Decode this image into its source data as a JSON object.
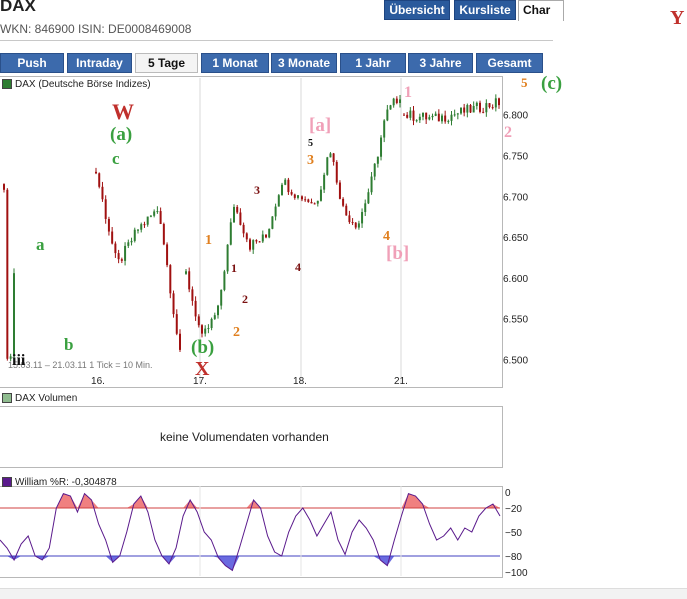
{
  "header": {
    "title": "DAX",
    "wkn_line": "WKN: 846900   ISIN: DE0008469008",
    "top_tabs": [
      {
        "label": "Übersicht",
        "active": false
      },
      {
        "label": "Kursliste",
        "active": false
      },
      {
        "label": "Char",
        "active": true
      }
    ]
  },
  "range_tabs": [
    "Push",
    "Intraday",
    "5 Tage",
    "1 Monat",
    "3 Monate",
    "1 Jahr",
    "3 Jahre",
    "Gesamt"
  ],
  "range_active": "5 Tage",
  "price_panel": {
    "legend": "DAX (Deutsche Börse Indizes)",
    "period_note": "15.03.11 – 21.03.11   1 Tick = 10 Min."
  },
  "volume_panel": {
    "legend": "DAX Volumen",
    "empty_message": "keine Volumendaten vorhanden"
  },
  "williams_panel": {
    "legend": "William %R: -0,304878"
  },
  "colors": {
    "up_candle": "#2e7d32",
    "down_candle": "#a01010",
    "overbought_fill": "#f08080",
    "oversold_fill": "#6a6ae0",
    "wr_line": "#5a1a8c",
    "tab_blue": "#3c6aac"
  },
  "annotations": [
    {
      "text": "Y",
      "color": "#c0302c",
      "size": 20
    },
    {
      "text": "5",
      "color": "#e08020",
      "size": 13
    },
    {
      "text": "(c)",
      "color": "#3aa040",
      "size": 19
    },
    {
      "text": "W",
      "color": "#c0302c",
      "size": 22
    },
    {
      "text": "(a)",
      "color": "#3aa040",
      "size": 19
    },
    {
      "text": "c",
      "color": "#3aa040",
      "size": 17
    },
    {
      "text": "a",
      "color": "#3aa040",
      "size": 17
    },
    {
      "text": "b",
      "color": "#3aa040",
      "size": 17
    },
    {
      "text": "iii",
      "color": "#111111",
      "size": 16
    },
    {
      "text": "(b)",
      "color": "#3aa040",
      "size": 19
    },
    {
      "text": "X",
      "color": "#c0302c",
      "size": 20
    },
    {
      "text": "1",
      "color": "#e08020",
      "size": 14
    },
    {
      "text": "1",
      "color": "#7a1010",
      "size": 12
    },
    {
      "text": "2",
      "color": "#7a1010",
      "size": 12
    },
    {
      "text": "2",
      "color": "#e08020",
      "size": 14
    },
    {
      "text": "3",
      "color": "#7a1010",
      "size": 12
    },
    {
      "text": "4",
      "color": "#7a1010",
      "size": 12
    },
    {
      "text": "5",
      "color": "#111111",
      "size": 10
    },
    {
      "text": "3",
      "color": "#e08020",
      "size": 14
    },
    {
      "text": "[a]",
      "color": "#f0a0b8",
      "size": 19
    },
    {
      "text": "4",
      "color": "#e08020",
      "size": 14
    },
    {
      "text": "[b]",
      "color": "#f0a0b8",
      "size": 19
    },
    {
      "text": "1",
      "color": "#f0a0b8",
      "size": 16
    },
    {
      "text": "2",
      "color": "#f0a0b8",
      "size": 16
    }
  ],
  "chart_data": [
    {
      "type": "candlestick",
      "title": "DAX (Deutsche Börse Indizes)",
      "x_tick_labels": [
        "16.",
        "17.",
        "18.",
        "21."
      ],
      "y_tick_labels": [
        "6.500",
        "6.550",
        "6.600",
        "6.650",
        "6.700",
        "6.750",
        "6.800"
      ],
      "ylim": [
        6470,
        6845
      ],
      "grid": "vertical at day boundaries",
      "series": [
        {
          "name": "DAX",
          "x": [
            "15.03. a",
            "15.03. b",
            "15.03. c",
            "15.03. d",
            "15.03. e",
            "15.03. f",
            "15.03. g",
            "16.03. a",
            "16.03. b",
            "16.03. c",
            "16.03. d",
            "16.03. e",
            "17.03. a",
            "17.03. b",
            "17.03. c",
            "17.03. d",
            "17.03. e",
            "17.03. f",
            "17.03. g",
            "17.03. h",
            "18.03. a",
            "18.03. b",
            "18.03. c",
            "18.03. d",
            "18.03. e",
            "18.03. f",
            "18.03. g",
            "18.03. h",
            "21.03. a",
            "21.03. b",
            "21.03. c",
            "21.03. d"
          ],
          "values": [
            6715,
            6605,
            6495,
            6610,
            6510,
            6545,
            6605,
            6730,
            6615,
            6660,
            6685,
            6505,
            6605,
            6525,
            6560,
            6690,
            6640,
            6650,
            6720,
            6700,
            6700,
            6690,
            6760,
            6680,
            6665,
            6720,
            6800,
            6825,
            6800,
            6795,
            6805,
            6815
          ]
        }
      ]
    },
    {
      "type": "line",
      "title": "William %R",
      "y_tick_labels": [
        "0",
        "-20",
        "-50",
        "-80",
        "-100"
      ],
      "ylim": [
        -100,
        0
      ],
      "reference_lines": [
        -20,
        -80
      ],
      "series": [
        {
          "name": "William %R",
          "values": [
            -60,
            -70,
            -85,
            -65,
            -55,
            -80,
            -85,
            -70,
            -20,
            -2,
            -5,
            -25,
            -2,
            -10,
            -40,
            -60,
            -88,
            -80,
            -50,
            -15,
            -5,
            -25,
            -60,
            -80,
            -90,
            -70,
            -30,
            -10,
            -25,
            -50,
            -60,
            -82,
            -92,
            -98,
            -70,
            -40,
            -10,
            -20,
            -55,
            -75,
            -80,
            -50,
            -30,
            -20,
            -35,
            -55,
            -40,
            -25,
            -60,
            -78,
            -50,
            -35,
            -45,
            -60,
            -85,
            -92,
            -60,
            -30,
            -2,
            -5,
            -15,
            -40,
            -60,
            -55,
            -45,
            -60,
            -45,
            -50,
            -30,
            -20,
            -15,
            -30
          ]
        }
      ]
    }
  ]
}
